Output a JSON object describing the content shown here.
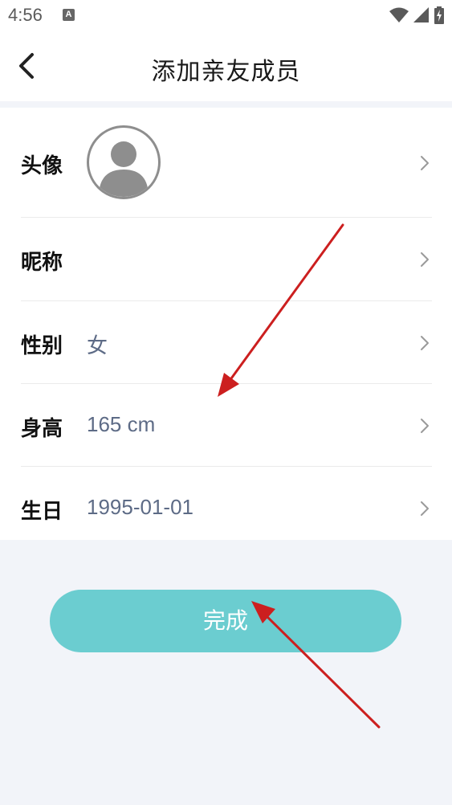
{
  "status_bar": {
    "time": "4:56",
    "notification_icon": "A",
    "icons": [
      "wifi-icon",
      "signal-icon",
      "battery-charging-icon"
    ]
  },
  "header": {
    "back_icon": "chevron-left-icon",
    "title": "添加亲友成员"
  },
  "form": {
    "rows": [
      {
        "label": "头像",
        "value": "",
        "type": "avatar"
      },
      {
        "label": "昵称",
        "value": ""
      },
      {
        "label": "性别",
        "value": "女"
      },
      {
        "label": "身高",
        "value": "165 cm"
      },
      {
        "label": "生日",
        "value": "1995-01-01"
      }
    ],
    "row_icon": "chevron-right-icon"
  },
  "footer": {
    "done_label": "完成"
  },
  "colors": {
    "accent": "#6bcdd0",
    "value_text": "#5d6b86",
    "background": "#f2f4f9",
    "annotation_arrow": "#cc1f1f"
  }
}
